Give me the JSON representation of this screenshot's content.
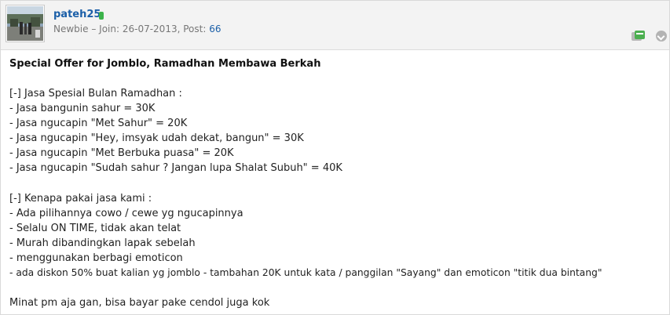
{
  "post": {
    "username": "pateh25",
    "rank": "Newbie",
    "join_label": "Join: 26-07-2013, Post:",
    "separator": "–",
    "post_count": "66",
    "title": "Special Offer for Jomblo, Ramadhan Membawa Berkah",
    "section1": {
      "heading": "[-] Jasa Spesial Bulan Ramadhan :",
      "items": [
        "- Jasa bangunin sahur = 30K",
        "- Jasa ngucapin \"Met Sahur\" = 20K",
        "- Jasa ngucapin \"Hey, imsyak udah dekat, bangun\" = 30K",
        "- Jasa ngucapin \"Met Berbuka puasa\" = 20K",
        "- Jasa ngucapin \"Sudah sahur ? Jangan lupa Shalat Subuh\" = 40K"
      ]
    },
    "section2": {
      "heading": "[-] Kenapa pakai jasa kami :",
      "items": [
        "- Ada pilihannya cowo / cewe yg ngucapinnya",
        "- Selalu ON TIME, tidak akan telat",
        "- Murah dibandingkan lapak sebelah",
        "- menggunakan berbagi emoticon",
        "- ada diskon 50% buat kalian yg jomblo - tambahan 20K untuk kata / panggilan \"Sayang\" dan emoticon \"titik dua bintang\""
      ]
    },
    "closing": "Minat pm aja gan, bisa bayar pake cendol juga kok"
  },
  "icons": {
    "avatar": "avatar-photo",
    "online": "online-status-icon",
    "reputation": "reputation-icon",
    "more": "more-options-icon"
  },
  "colors": {
    "link": "#1b5fa8",
    "online": "#3cb34a",
    "header_bg": "#f3f3f3"
  }
}
